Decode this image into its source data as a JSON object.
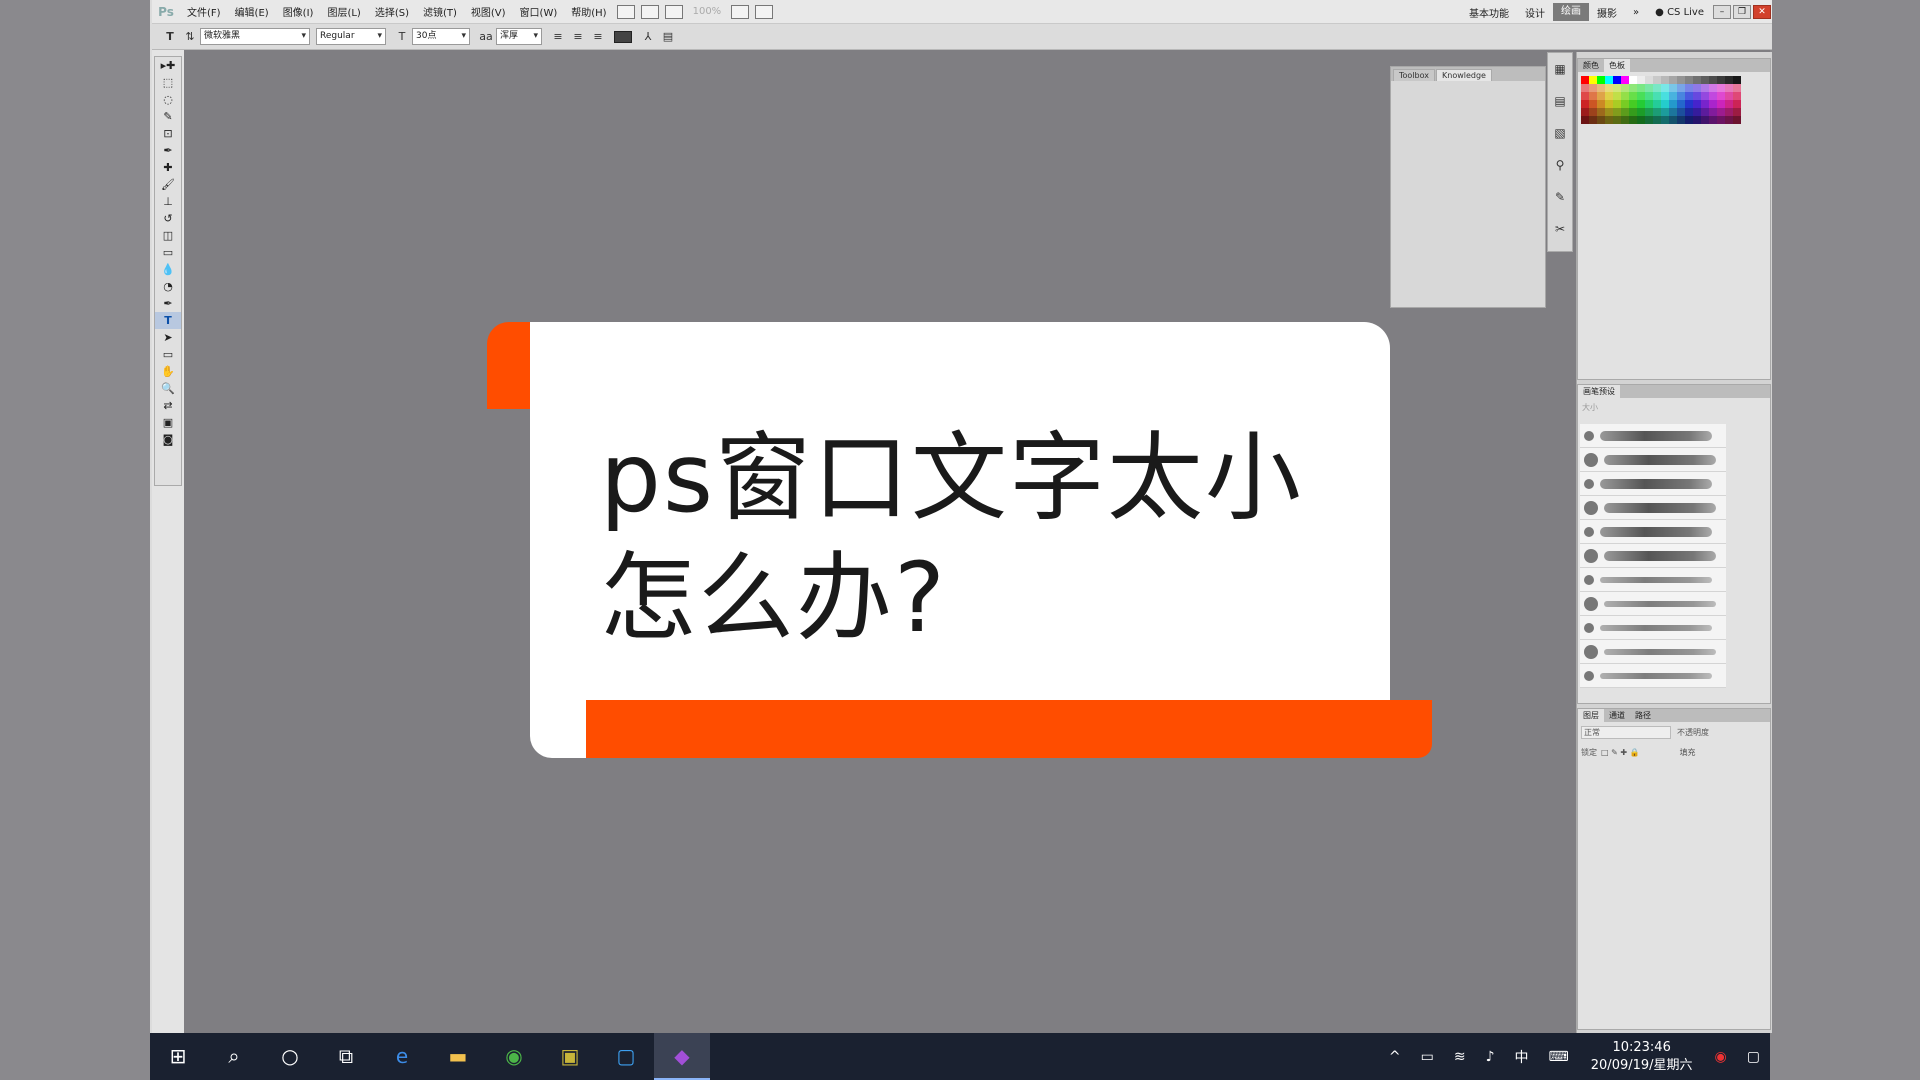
{
  "app": {
    "logo": "Ps",
    "menu": [
      "文件(F)",
      "编辑(E)",
      "图像(I)",
      "图层(L)",
      "选择(S)",
      "滤镜(T)",
      "视图(V)",
      "窗口(W)",
      "帮助(H)"
    ],
    "zoom": "100%",
    "workspaces": [
      "基本功能",
      "设计",
      "绘画",
      "摄影"
    ],
    "active_workspace": "绘画",
    "overflow": "»",
    "cs_live": "CS Live"
  },
  "options": {
    "tool_icon": "T",
    "font_family": "微软雅黑",
    "font_style": "Regular",
    "font_size": "30点",
    "antialias": "浑厚",
    "aa_label": "aa"
  },
  "toolbox": {
    "tools": [
      "move",
      "marquee",
      "lasso",
      "quick-select",
      "crop",
      "eyedropper",
      "healing",
      "brush",
      "stamp",
      "history-brush",
      "eraser",
      "gradient",
      "blur",
      "dodge",
      "pen",
      "type",
      "path-select",
      "shape",
      "hand",
      "zoom"
    ],
    "glyphs": [
      "▸✚",
      "⬚",
      "◌",
      "✎",
      "⊡",
      "✒",
      "✚",
      "🖌",
      "⊥",
      "↺",
      "◫",
      "▭",
      "💧",
      "◔",
      "✒",
      "T",
      "➤",
      "▭",
      "✋",
      "🔍"
    ],
    "active": "type"
  },
  "float_panel": {
    "tabs": [
      "Toolbox",
      "Knowledge"
    ],
    "active_tab": "Knowledge"
  },
  "dock": {
    "swatch_tabs": [
      "颜色",
      "色板"
    ],
    "brush_tabs": [
      "画笔预设"
    ],
    "brush_size_label": "大小",
    "layers_tabs": [
      "图层",
      "通道",
      "路径"
    ],
    "blend_mode": "正常",
    "opacity_label": "不透明度",
    "lock_label": "锁定",
    "fill_label": "填充",
    "brush_count": 11
  },
  "card": {
    "title_line1": "ps窗口文字太小",
    "title_line2": "怎么办?",
    "accent_color": "#ff4d00"
  },
  "taskbar": {
    "icons": [
      "windows-start",
      "search",
      "cortana",
      "task-view",
      "edge",
      "file-explorer",
      "browser",
      "app-green",
      "app-blue",
      "photoshop"
    ],
    "tray": [
      "^",
      "battery",
      "wifi",
      "volume",
      "中",
      "keyboard"
    ],
    "ime": "中",
    "time": "10:23:46",
    "date": "20/09/19/星期六"
  },
  "colors": {
    "accent_orange": "#ff4d00",
    "canvas_gray": "#7f7e82",
    "taskbar": "#1a2130"
  }
}
